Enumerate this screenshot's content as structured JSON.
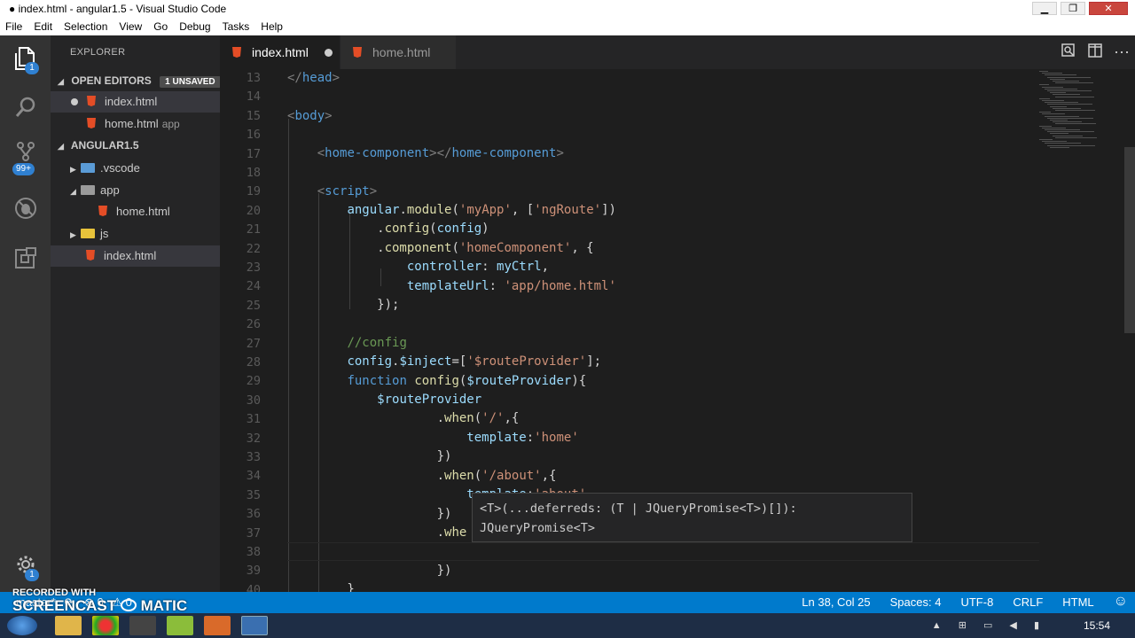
{
  "window": {
    "title": "● index.html - angular1.5 - Visual Studio Code",
    "minimize": "▁",
    "maximize": "❐",
    "close": "✕"
  },
  "menu": [
    "File",
    "Edit",
    "Selection",
    "View",
    "Go",
    "Debug",
    "Tasks",
    "Help"
  ],
  "activity": {
    "explorer_badge": "1",
    "scm_badge": "99+",
    "settings_badge": "1"
  },
  "sidebar": {
    "title": "EXPLORER",
    "open_editors": "OPEN EDITORS",
    "unsaved": "1 UNSAVED",
    "open_files": [
      {
        "name": "index.html",
        "hint": ""
      },
      {
        "name": "home.html",
        "hint": "app"
      }
    ],
    "project": "ANGULAR1.5",
    "tree": [
      {
        "name": ".vscode"
      },
      {
        "name": "app"
      },
      {
        "name": "home.html"
      },
      {
        "name": "js"
      },
      {
        "name": "index.html"
      }
    ]
  },
  "tabs": [
    {
      "label": "index.html",
      "modified": true
    },
    {
      "label": "home.html",
      "modified": false
    }
  ],
  "editor": {
    "line_numbers": [
      "13",
      "14",
      "15",
      "16",
      "17",
      "18",
      "19",
      "20",
      "21",
      "22",
      "23",
      "24",
      "25",
      "26",
      "27",
      "28",
      "29",
      "30",
      "31",
      "32",
      "33",
      "34",
      "35",
      "36",
      "37",
      "38",
      "39",
      "40"
    ],
    "tooltip_line1": "<T>(...deferreds: (T | JQueryPromise<T>)[]):",
    "tooltip_line2": "JQueryPromise<T>"
  },
  "status": {
    "branch": "master*",
    "sync": "⟳",
    "errors": "⊗ 0",
    "warnings": "⚠ 0",
    "position": "Ln 38, Col 25",
    "spaces": "Spaces: 4",
    "encoding": "UTF-8",
    "eol": "CRLF",
    "language": "HTML",
    "feedback": "☺"
  },
  "watermark": {
    "line1": "RECORDED WITH",
    "line2": "SCREENCAST",
    "line3": "MATIC"
  },
  "taskbar": {
    "clock": "15:54"
  }
}
